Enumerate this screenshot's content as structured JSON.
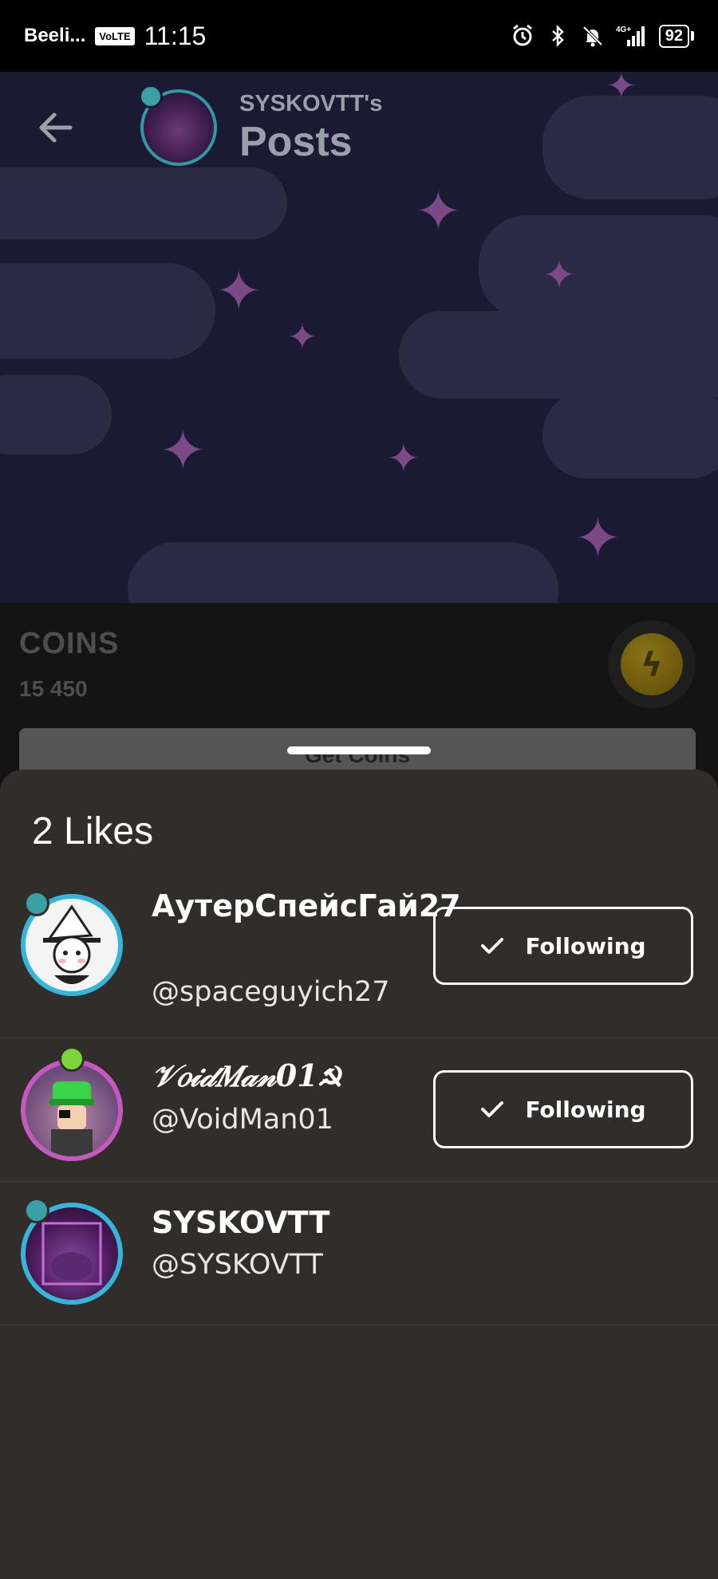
{
  "status_bar": {
    "carrier": "Beeli...",
    "volte": "VoLTE",
    "time": "11:15",
    "network": "4G+",
    "battery": "92",
    "icons": [
      "alarm-icon",
      "bluetooth-icon",
      "bell-off-icon",
      "signal-icon",
      "battery-icon"
    ]
  },
  "header": {
    "owner": "SYSKOVTT's",
    "title": "Posts",
    "back_icon": "arrow-left-icon"
  },
  "coins": {
    "label": "COINS",
    "value": "15 450",
    "button_label": "Get Coins"
  },
  "likes_sheet": {
    "title": "2 Likes",
    "users": [
      {
        "display_name": "АутерСпейсГай27",
        "handle": "@spaceguyich27",
        "follow_label": "Following",
        "following": true
      },
      {
        "display_name": "𝒱𝑜𝒾𝒹𝑀𝒶𝓃01☭",
        "handle": "@VoidMan01",
        "follow_label": "Following",
        "following": true
      },
      {
        "display_name": "SYSKOVTT",
        "handle": "@SYSKOVTT",
        "follow_label": "",
        "following": false
      }
    ]
  },
  "colors": {
    "sheet_bg": "#302d2a",
    "banner_bg": "#1a1a32",
    "avatar_ring": "#35b6d8",
    "divider": "#45413d"
  }
}
